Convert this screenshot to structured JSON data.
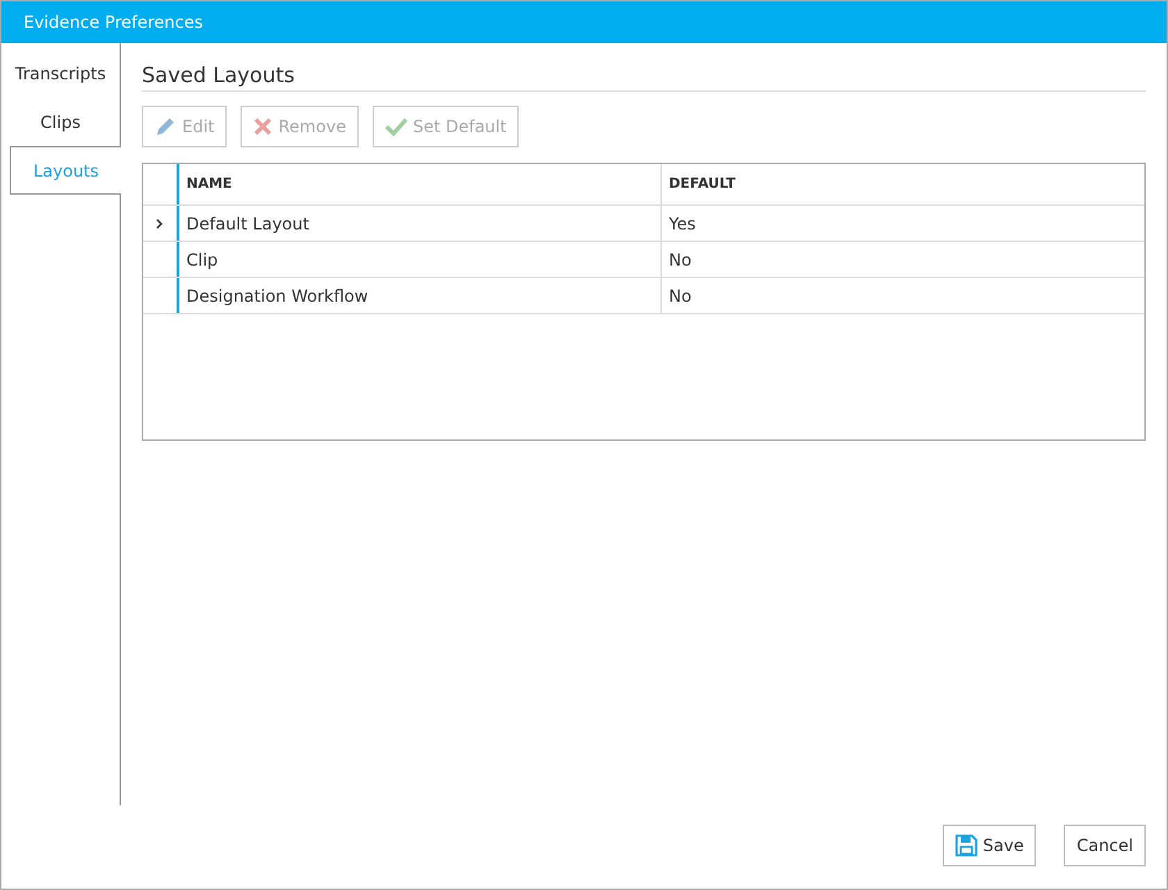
{
  "window": {
    "title": "Evidence Preferences"
  },
  "tabs": [
    {
      "label": "Transcripts",
      "selected": false
    },
    {
      "label": "Clips",
      "selected": false
    },
    {
      "label": "Layouts",
      "selected": true
    }
  ],
  "section_title": "Saved Layouts",
  "toolbar": [
    {
      "kind": "edit",
      "label": "Edit",
      "disabled": true
    },
    {
      "kind": "remove",
      "label": "Remove",
      "disabled": true
    },
    {
      "kind": "default",
      "label": "Set Default",
      "disabled": true
    }
  ],
  "table": {
    "columns": [
      "NAME",
      "DEFAULT"
    ],
    "rows": [
      {
        "cells": [
          "Default Layout",
          "Yes"
        ],
        "current": true
      },
      {
        "cells": [
          "Clip",
          "No"
        ],
        "current": false
      },
      {
        "cells": [
          "Designation Workflow",
          "No"
        ],
        "current": false
      }
    ]
  },
  "footer_buttons": [
    {
      "kind": "save",
      "label": "Save"
    },
    {
      "kind": "cancel",
      "label": "Cancel"
    }
  ]
}
